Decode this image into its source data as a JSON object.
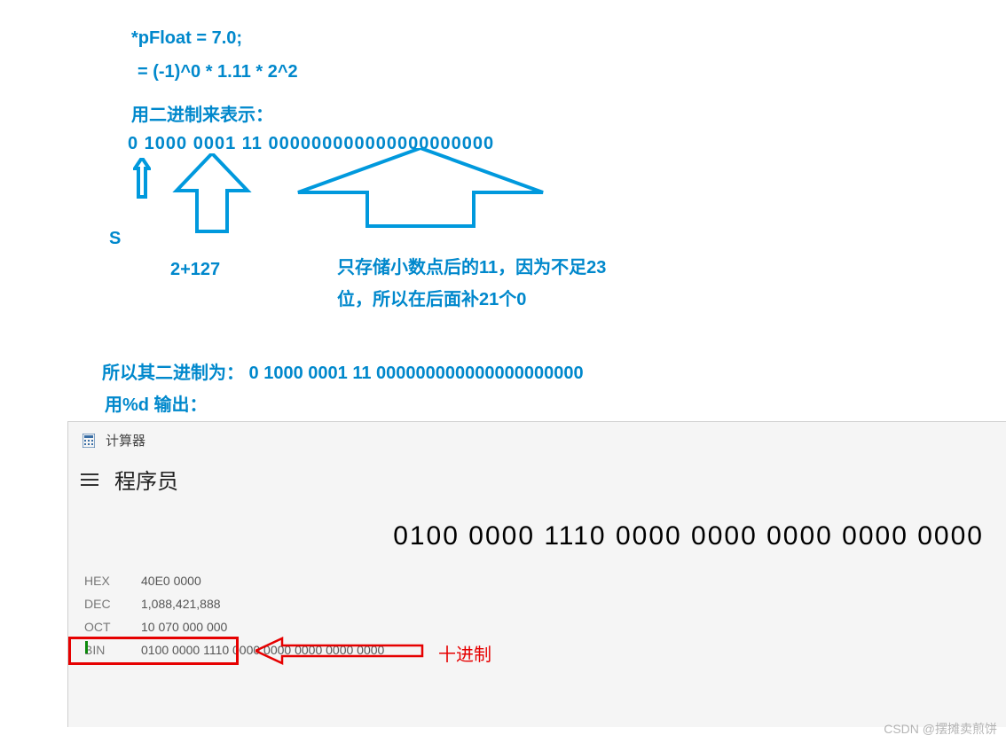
{
  "annotations": {
    "line1": "*pFloat = 7.0;",
    "line2": "=   (-1)^0 * 1.11 * 2^2",
    "line3": "用二进制来表示：",
    "line4": "0   1000 0001    11 000000000000000000000",
    "sign_label": "S",
    "exp_label": "2+127",
    "mantissa_line1": "只存储小数点后的11，因为不足23",
    "mantissa_line2": "位，所以在后面补21个0",
    "binary_line": "所以其二进制为：   0   1000 0001    11 000000000000000000000",
    "printf_line": "用%d 输出："
  },
  "calculator": {
    "app_title": "计算器",
    "mode": "程序员",
    "display": "0100 0000 1110 0000 0000 0000 0000 0000",
    "hex_label": "HEX",
    "hex_value": "40E0 0000",
    "dec_label": "DEC",
    "dec_value": "1,088,421,888",
    "oct_label": "OCT",
    "oct_value": "10 070 000 000",
    "bin_label": "BIN",
    "bin_value": "0100 0000 1110 0000 0000 0000 0000 0000"
  },
  "red_label": "十进制",
  "watermark": "CSDN @摆摊卖煎饼"
}
